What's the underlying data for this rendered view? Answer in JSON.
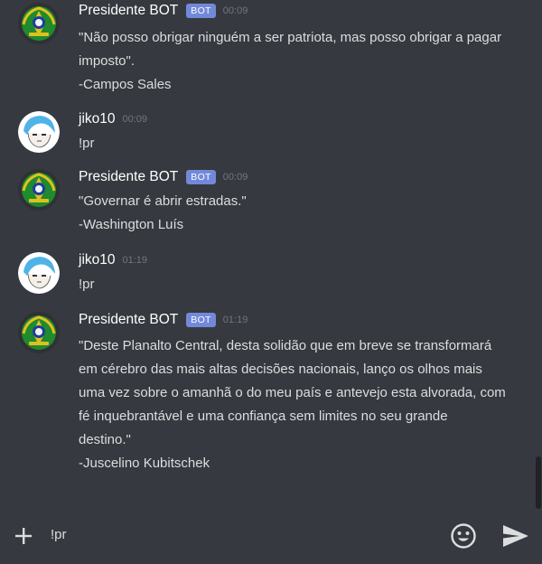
{
  "messages": [
    {
      "author": "Presidente BOT",
      "badge": "BOT",
      "time": "00:09",
      "avatar": "brazil-coat-of-arms-icon",
      "lines": [
        "\"Não posso obrigar ninguém a ser patriota, mas posso obrigar a pagar",
        "imposto\".",
        "-Campos Sales"
      ]
    },
    {
      "author": "jiko10",
      "time": "00:09",
      "avatar": "anime-user-icon",
      "lines": [
        "!pr"
      ]
    },
    {
      "author": "Presidente BOT",
      "badge": "BOT",
      "time": "00:09",
      "avatar": "brazil-coat-of-arms-icon",
      "lines": [
        "\"Governar é abrir estradas.\"",
        "-Washington Luís"
      ]
    },
    {
      "author": "jiko10",
      "time": "01:19",
      "avatar": "anime-user-icon",
      "lines": [
        "!pr"
      ]
    },
    {
      "author": "Presidente BOT",
      "badge": "BOT",
      "time": "01:19",
      "avatar": "brazil-coat-of-arms-icon",
      "lines": [
        "\"Deste Planalto Central, desta solidão que em breve se transformará",
        "em cérebro das mais altas decisões nacionais, lanço os olhos mais",
        "uma vez sobre o amanhã o do meu país e antevejo esta alvorada, com",
        "fé inquebrantável e uma confiança sem limites no seu grande",
        "destino.\"",
        "-Juscelino Kubitschek"
      ]
    }
  ],
  "composer": {
    "input_value": "!pr",
    "icons": [
      "plus-icon",
      "emoji-icon",
      "send-icon"
    ]
  },
  "colors": {
    "background": "#36393f",
    "bot_badge": "#7289da",
    "timestamp": "#72767d",
    "text": "#dcddde"
  }
}
